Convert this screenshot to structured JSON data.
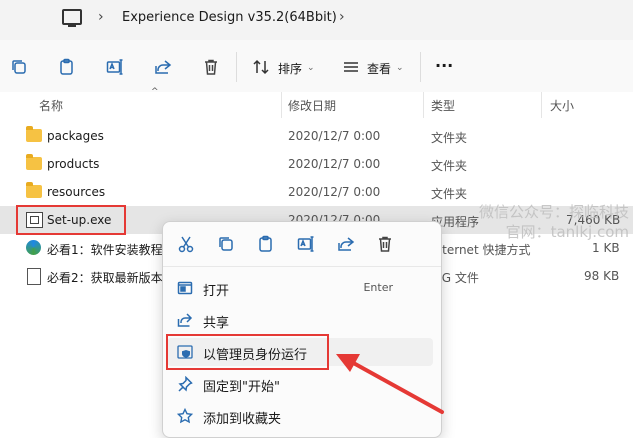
{
  "address": {
    "crumb": "Experience Design v35.2(64Bbit)"
  },
  "toolbar": {
    "sort_label": "排序",
    "view_label": "查看",
    "more_label": "···"
  },
  "columns": {
    "name": "名称",
    "date": "修改日期",
    "type": "类型",
    "size": "大小"
  },
  "files": [
    {
      "name": "packages",
      "date": "2020/12/7 0:00",
      "type": "文件夹",
      "size": "",
      "icon": "folder-icon"
    },
    {
      "name": "products",
      "date": "2020/12/7 0:00",
      "type": "文件夹",
      "size": "",
      "icon": "folder-icon"
    },
    {
      "name": "resources",
      "date": "2020/12/7 0:00",
      "type": "文件夹",
      "size": "",
      "icon": "folder-icon"
    },
    {
      "name": "Set-up.exe",
      "date": "2020/12/7 0:00",
      "type": "应用程序",
      "size": "7,460 KB",
      "icon": "exe-icon"
    },
    {
      "name": "必看1：软件安装教程",
      "date": "",
      "type": "Internet 快捷方式",
      "size": "1 KB",
      "icon": "edge-icon"
    },
    {
      "name": "必看2：获取最新版本",
      "date": "",
      "type": "JPG 文件",
      "size": "98 KB",
      "icon": "file-icon"
    }
  ],
  "context_menu": {
    "items": [
      {
        "label": "打开",
        "shortcut": "Enter",
        "icon": "open-icon"
      },
      {
        "label": "共享",
        "shortcut": "",
        "icon": "share-icon"
      },
      {
        "label": "以管理员身份运行",
        "shortcut": "",
        "icon": "shield-icon"
      },
      {
        "label": "固定到\"开始\"",
        "shortcut": "",
        "icon": "pin-icon"
      },
      {
        "label": "添加到收藏夹",
        "shortcut": "",
        "icon": "star-icon"
      }
    ]
  },
  "watermark": {
    "line1": "微信公众号：探临科技",
    "line2": "官网：tanlkj.com"
  },
  "colors": {
    "accent": "#2b6cb0",
    "annotation": "#e53935"
  }
}
